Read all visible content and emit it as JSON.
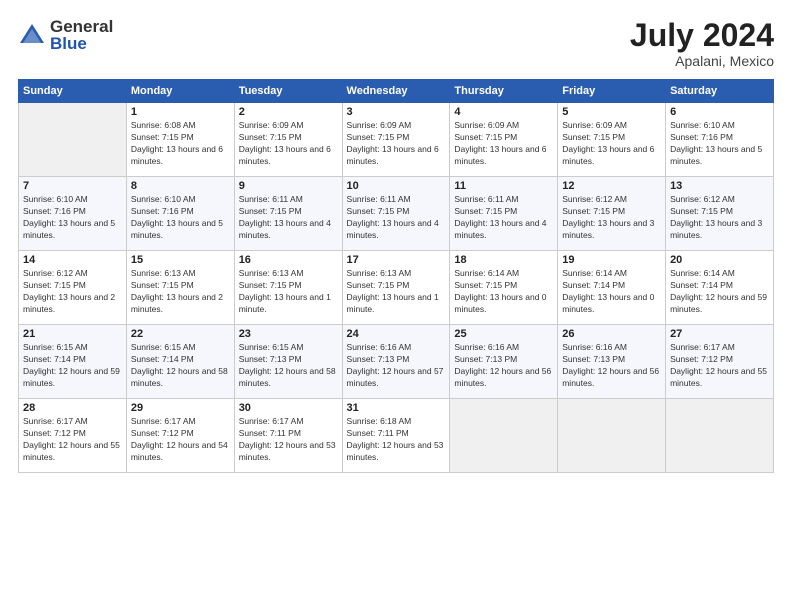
{
  "header": {
    "logo_general": "General",
    "logo_blue": "Blue",
    "month_year": "July 2024",
    "location": "Apalani, Mexico"
  },
  "weekdays": [
    "Sunday",
    "Monday",
    "Tuesday",
    "Wednesday",
    "Thursday",
    "Friday",
    "Saturday"
  ],
  "weeks": [
    [
      {
        "day": "",
        "empty": true
      },
      {
        "day": "1",
        "sunrise": "6:08 AM",
        "sunset": "7:15 PM",
        "daylight": "13 hours and 6 minutes."
      },
      {
        "day": "2",
        "sunrise": "6:09 AM",
        "sunset": "7:15 PM",
        "daylight": "13 hours and 6 minutes."
      },
      {
        "day": "3",
        "sunrise": "6:09 AM",
        "sunset": "7:15 PM",
        "daylight": "13 hours and 6 minutes."
      },
      {
        "day": "4",
        "sunrise": "6:09 AM",
        "sunset": "7:15 PM",
        "daylight": "13 hours and 6 minutes."
      },
      {
        "day": "5",
        "sunrise": "6:09 AM",
        "sunset": "7:15 PM",
        "daylight": "13 hours and 6 minutes."
      },
      {
        "day": "6",
        "sunrise": "6:10 AM",
        "sunset": "7:16 PM",
        "daylight": "13 hours and 5 minutes."
      }
    ],
    [
      {
        "day": "7",
        "sunrise": "6:10 AM",
        "sunset": "7:16 PM",
        "daylight": "13 hours and 5 minutes."
      },
      {
        "day": "8",
        "sunrise": "6:10 AM",
        "sunset": "7:16 PM",
        "daylight": "13 hours and 5 minutes."
      },
      {
        "day": "9",
        "sunrise": "6:11 AM",
        "sunset": "7:15 PM",
        "daylight": "13 hours and 4 minutes."
      },
      {
        "day": "10",
        "sunrise": "6:11 AM",
        "sunset": "7:15 PM",
        "daylight": "13 hours and 4 minutes."
      },
      {
        "day": "11",
        "sunrise": "6:11 AM",
        "sunset": "7:15 PM",
        "daylight": "13 hours and 4 minutes."
      },
      {
        "day": "12",
        "sunrise": "6:12 AM",
        "sunset": "7:15 PM",
        "daylight": "13 hours and 3 minutes."
      },
      {
        "day": "13",
        "sunrise": "6:12 AM",
        "sunset": "7:15 PM",
        "daylight": "13 hours and 3 minutes."
      }
    ],
    [
      {
        "day": "14",
        "sunrise": "6:12 AM",
        "sunset": "7:15 PM",
        "daylight": "13 hours and 2 minutes."
      },
      {
        "day": "15",
        "sunrise": "6:13 AM",
        "sunset": "7:15 PM",
        "daylight": "13 hours and 2 minutes."
      },
      {
        "day": "16",
        "sunrise": "6:13 AM",
        "sunset": "7:15 PM",
        "daylight": "13 hours and 1 minute."
      },
      {
        "day": "17",
        "sunrise": "6:13 AM",
        "sunset": "7:15 PM",
        "daylight": "13 hours and 1 minute."
      },
      {
        "day": "18",
        "sunrise": "6:14 AM",
        "sunset": "7:15 PM",
        "daylight": "13 hours and 0 minutes."
      },
      {
        "day": "19",
        "sunrise": "6:14 AM",
        "sunset": "7:14 PM",
        "daylight": "13 hours and 0 minutes."
      },
      {
        "day": "20",
        "sunrise": "6:14 AM",
        "sunset": "7:14 PM",
        "daylight": "12 hours and 59 minutes."
      }
    ],
    [
      {
        "day": "21",
        "sunrise": "6:15 AM",
        "sunset": "7:14 PM",
        "daylight": "12 hours and 59 minutes."
      },
      {
        "day": "22",
        "sunrise": "6:15 AM",
        "sunset": "7:14 PM",
        "daylight": "12 hours and 58 minutes."
      },
      {
        "day": "23",
        "sunrise": "6:15 AM",
        "sunset": "7:13 PM",
        "daylight": "12 hours and 58 minutes."
      },
      {
        "day": "24",
        "sunrise": "6:16 AM",
        "sunset": "7:13 PM",
        "daylight": "12 hours and 57 minutes."
      },
      {
        "day": "25",
        "sunrise": "6:16 AM",
        "sunset": "7:13 PM",
        "daylight": "12 hours and 56 minutes."
      },
      {
        "day": "26",
        "sunrise": "6:16 AM",
        "sunset": "7:13 PM",
        "daylight": "12 hours and 56 minutes."
      },
      {
        "day": "27",
        "sunrise": "6:17 AM",
        "sunset": "7:12 PM",
        "daylight": "12 hours and 55 minutes."
      }
    ],
    [
      {
        "day": "28",
        "sunrise": "6:17 AM",
        "sunset": "7:12 PM",
        "daylight": "12 hours and 55 minutes."
      },
      {
        "day": "29",
        "sunrise": "6:17 AM",
        "sunset": "7:12 PM",
        "daylight": "12 hours and 54 minutes."
      },
      {
        "day": "30",
        "sunrise": "6:17 AM",
        "sunset": "7:11 PM",
        "daylight": "12 hours and 53 minutes."
      },
      {
        "day": "31",
        "sunrise": "6:18 AM",
        "sunset": "7:11 PM",
        "daylight": "12 hours and 53 minutes."
      },
      {
        "day": "",
        "empty": true
      },
      {
        "day": "",
        "empty": true
      },
      {
        "day": "",
        "empty": true
      }
    ]
  ]
}
